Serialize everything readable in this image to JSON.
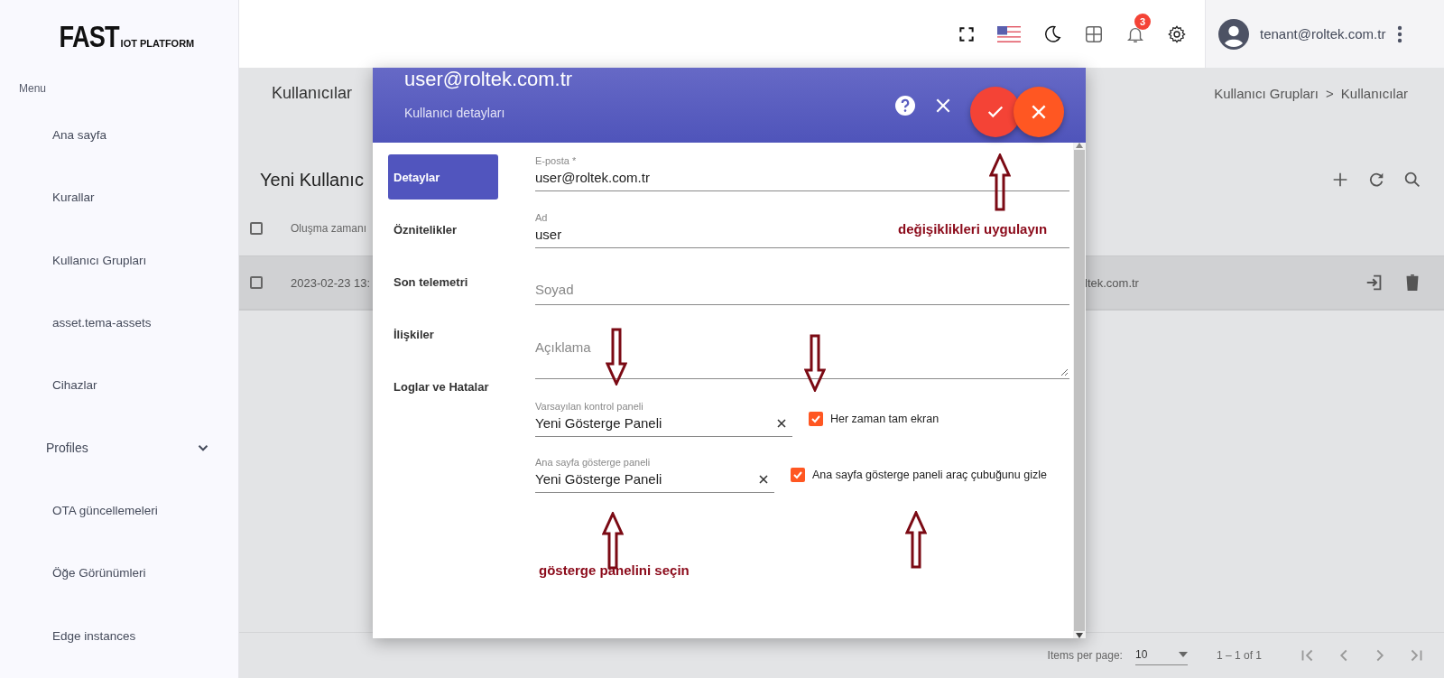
{
  "logo": {
    "title": "FAST",
    "subtitle": "IOT PLATFORM"
  },
  "sidebar": {
    "heading": "Menu",
    "items": [
      {
        "label": "Ana sayfa",
        "kind": "link"
      },
      {
        "label": "Kurallar",
        "kind": "link"
      },
      {
        "label": "Kullanıcı Grupları",
        "kind": "link"
      },
      {
        "label": "asset.tema-assets",
        "kind": "link"
      },
      {
        "label": "Cihazlar",
        "kind": "link"
      },
      {
        "label": "Profiles",
        "kind": "group",
        "expanded": false
      },
      {
        "label": "OTA güncellemeleri",
        "kind": "link"
      },
      {
        "label": "Öğe Görünümleri",
        "kind": "link"
      },
      {
        "label": "Edge instances",
        "kind": "link"
      }
    ]
  },
  "toolbar": {
    "notification_count": "3",
    "user": "tenant@roltek.com.tr"
  },
  "page": {
    "title": "Kullanıcılar",
    "breadcrumb": [
      "Kullanıcı Grupları",
      "Kullanıcılar"
    ],
    "breadcrumb_separator": ">"
  },
  "table": {
    "title": "Yeni Kullanıc",
    "header_checked": false,
    "columns": [
      "Oluşma zamanı"
    ],
    "rows": [
      {
        "checked": false,
        "cells": [
          "2023-02-23 13:",
          "ltek.com.tr"
        ]
      }
    ]
  },
  "paginator": {
    "label": "Items per page:",
    "page_size": "10",
    "range": "1 – 1 of 1"
  },
  "dialog": {
    "title": "user@roltek.com.tr",
    "subtitle": "Kullanıcı detayları",
    "tabs": [
      {
        "label": "Detaylar",
        "selected": true
      },
      {
        "label": "Öznitelikler",
        "selected": false
      },
      {
        "label": "Son telemetri",
        "selected": false
      },
      {
        "label": "İlişkiler",
        "selected": false
      },
      {
        "label": "Loglar ve Hatalar",
        "selected": false
      }
    ],
    "fields": [
      {
        "kind": "text",
        "label": "E-posta *",
        "value": "user@roltek.com.tr"
      },
      {
        "kind": "text",
        "label": "Ad",
        "value": "user"
      },
      {
        "kind": "text",
        "placeholder": "Soyad"
      },
      {
        "kind": "textarea",
        "placeholder": "Açıklama"
      },
      {
        "kind": "select",
        "label": "Varsayılan kontrol paneli",
        "value": "Yeni Gösterge Paneli",
        "option": {
          "label": "Her zaman tam ekran",
          "checked": true
        }
      },
      {
        "kind": "select",
        "label": "Ana sayfa gösterge paneli",
        "value": "Yeni Gösterge Paneli",
        "option": {
          "label": "Ana sayfa gösterge paneli araç çubuğunu gizle",
          "checked": true
        }
      }
    ]
  },
  "annotations": [
    "değişiklikleri uygulayın",
    "gösterge panelini seçin"
  ]
}
